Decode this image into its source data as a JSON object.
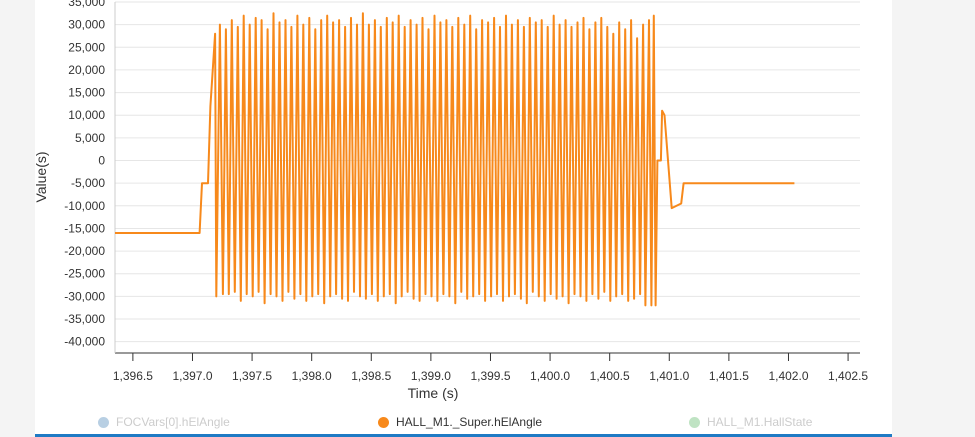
{
  "chart_data": {
    "type": "line",
    "xlabel": "Time (s)",
    "ylabel": "Value(s)",
    "xlim": [
      1396.35,
      1402.6
    ],
    "ylim": [
      -42500,
      35000
    ],
    "x_ticks": [
      "1,396.5",
      "1,397.0",
      "1,397.5",
      "1,398.0",
      "1,398.5",
      "1,399.0",
      "1,399.5",
      "1,400.0",
      "1,400.5",
      "1,401.0",
      "1,401.5",
      "1,402.0",
      "1,402.5"
    ],
    "x_tick_values": [
      1396.5,
      1397.0,
      1397.5,
      1398.0,
      1398.5,
      1399.0,
      1399.5,
      1400.0,
      1400.5,
      1401.0,
      1401.5,
      1402.0,
      1402.5
    ],
    "y_ticks": [
      "35,000",
      "30,000",
      "25,000",
      "20,000",
      "15,000",
      "10,000",
      "5,000",
      "0",
      "-5,000",
      "-10,000",
      "-15,000",
      "-20,000",
      "-25,000",
      "-30,000",
      "-35,000",
      "-40,000"
    ],
    "y_tick_values": [
      35000,
      30000,
      25000,
      20000,
      15000,
      10000,
      5000,
      0,
      -5000,
      -10000,
      -15000,
      -20000,
      -25000,
      -30000,
      -35000,
      -40000
    ],
    "grid": true,
    "legend_placement": "bottom",
    "series": [
      {
        "name": "FOCVars[0].hElAngle",
        "color": "#b8cfe3",
        "visible": false,
        "points": []
      },
      {
        "name": "HALL_M1._Super.hElAngle",
        "color": "#f7891b",
        "visible": true,
        "points": [
          [
            1396.35,
            -16000
          ],
          [
            1397.06,
            -16000
          ],
          [
            1397.08,
            -5000
          ],
          [
            1397.13,
            -5000
          ],
          [
            1397.15,
            12000
          ],
          [
            1397.19,
            28000
          ],
          [
            1397.2,
            -30000
          ],
          [
            1397.23,
            30000
          ],
          [
            1397.255,
            -29500
          ],
          [
            1397.28,
            29000
          ],
          [
            1397.305,
            -29500
          ],
          [
            1397.33,
            31000
          ],
          [
            1397.355,
            -29000
          ],
          [
            1397.38,
            29500
          ],
          [
            1397.405,
            -31000
          ],
          [
            1397.43,
            32000
          ],
          [
            1397.455,
            -29500
          ],
          [
            1397.48,
            30000
          ],
          [
            1397.505,
            -30000
          ],
          [
            1397.53,
            31500
          ],
          [
            1397.555,
            -29000
          ],
          [
            1397.58,
            31000
          ],
          [
            1397.605,
            -31500
          ],
          [
            1397.63,
            29000
          ],
          [
            1397.655,
            -29500
          ],
          [
            1397.68,
            32500
          ],
          [
            1397.705,
            -30000
          ],
          [
            1397.73,
            30500
          ],
          [
            1397.755,
            -31000
          ],
          [
            1397.78,
            31000
          ],
          [
            1397.805,
            -29000
          ],
          [
            1397.83,
            29500
          ],
          [
            1397.855,
            -30500
          ],
          [
            1397.88,
            32000
          ],
          [
            1397.905,
            -29500
          ],
          [
            1397.93,
            30000
          ],
          [
            1397.955,
            -31000
          ],
          [
            1397.98,
            31500
          ],
          [
            1398.005,
            -30000
          ],
          [
            1398.03,
            29000
          ],
          [
            1398.055,
            -29500
          ],
          [
            1398.08,
            31000
          ],
          [
            1398.105,
            -31500
          ],
          [
            1398.13,
            32000
          ],
          [
            1398.155,
            -30000
          ],
          [
            1398.18,
            30500
          ],
          [
            1398.205,
            -29500
          ],
          [
            1398.23,
            31000
          ],
          [
            1398.255,
            -30500
          ],
          [
            1398.28,
            29500
          ],
          [
            1398.305,
            -31000
          ],
          [
            1398.33,
            31500
          ],
          [
            1398.355,
            -29000
          ],
          [
            1398.38,
            30000
          ],
          [
            1398.405,
            -30000
          ],
          [
            1398.43,
            32500
          ],
          [
            1398.455,
            -30500
          ],
          [
            1398.48,
            30000
          ],
          [
            1398.505,
            -29500
          ],
          [
            1398.53,
            31000
          ],
          [
            1398.555,
            -31000
          ],
          [
            1398.58,
            29500
          ],
          [
            1398.605,
            -30000
          ],
          [
            1398.63,
            31500
          ],
          [
            1398.655,
            -29500
          ],
          [
            1398.68,
            30500
          ],
          [
            1398.705,
            -31500
          ],
          [
            1398.73,
            32000
          ],
          [
            1398.755,
            -30000
          ],
          [
            1398.78,
            29500
          ],
          [
            1398.805,
            -29000
          ],
          [
            1398.83,
            31000
          ],
          [
            1398.855,
            -30500
          ],
          [
            1398.88,
            30000
          ],
          [
            1398.905,
            -31000
          ],
          [
            1398.93,
            31500
          ],
          [
            1398.955,
            -29500
          ],
          [
            1398.98,
            29000
          ],
          [
            1399.005,
            -30000
          ],
          [
            1399.03,
            32000
          ],
          [
            1399.055,
            -31000
          ],
          [
            1399.08,
            30500
          ],
          [
            1399.105,
            -29500
          ],
          [
            1399.13,
            31000
          ],
          [
            1399.155,
            -30000
          ],
          [
            1399.18,
            29500
          ],
          [
            1399.205,
            -31500
          ],
          [
            1399.23,
            31500
          ],
          [
            1399.255,
            -29000
          ],
          [
            1399.28,
            30000
          ],
          [
            1399.305,
            -30500
          ],
          [
            1399.33,
            32000
          ],
          [
            1399.355,
            -30000
          ],
          [
            1399.38,
            29000
          ],
          [
            1399.405,
            -29500
          ],
          [
            1399.43,
            31000
          ],
          [
            1399.455,
            -31000
          ],
          [
            1399.48,
            30500
          ],
          [
            1399.505,
            -30000
          ],
          [
            1399.53,
            31500
          ],
          [
            1399.555,
            -29500
          ],
          [
            1399.58,
            29500
          ],
          [
            1399.605,
            -31000
          ],
          [
            1399.63,
            32000
          ],
          [
            1399.655,
            -30000
          ],
          [
            1399.68,
            30000
          ],
          [
            1399.705,
            -29500
          ],
          [
            1399.73,
            31000
          ],
          [
            1399.755,
            -30500
          ],
          [
            1399.78,
            29500
          ],
          [
            1399.805,
            -31500
          ],
          [
            1399.83,
            31500
          ],
          [
            1399.855,
            -29000
          ],
          [
            1399.88,
            30500
          ],
          [
            1399.905,
            -30000
          ],
          [
            1399.93,
            31000
          ],
          [
            1399.955,
            -31000
          ],
          [
            1399.98,
            29500
          ],
          [
            1400.005,
            -29500
          ],
          [
            1400.03,
            32000
          ],
          [
            1400.055,
            -30500
          ],
          [
            1400.08,
            30000
          ],
          [
            1400.105,
            -30000
          ],
          [
            1400.13,
            31000
          ],
          [
            1400.155,
            -31500
          ],
          [
            1400.18,
            29500
          ],
          [
            1400.205,
            -29500
          ],
          [
            1400.23,
            30500
          ],
          [
            1400.255,
            -30000
          ],
          [
            1400.28,
            31500
          ],
          [
            1400.305,
            -31000
          ],
          [
            1400.33,
            29000
          ],
          [
            1400.355,
            -29500
          ],
          [
            1400.38,
            30500
          ],
          [
            1400.405,
            -30500
          ],
          [
            1400.43,
            31500
          ],
          [
            1400.455,
            -29000
          ],
          [
            1400.48,
            29500
          ],
          [
            1400.505,
            -31000
          ],
          [
            1400.53,
            28000
          ],
          [
            1400.555,
            -30000
          ],
          [
            1400.58,
            30500
          ],
          [
            1400.605,
            -29500
          ],
          [
            1400.63,
            29000
          ],
          [
            1400.655,
            -31000
          ],
          [
            1400.68,
            31000
          ],
          [
            1400.705,
            -30500
          ],
          [
            1400.73,
            27000
          ],
          [
            1400.755,
            -29500
          ],
          [
            1400.78,
            30000
          ],
          [
            1400.8,
            -32000
          ],
          [
            1400.83,
            31000
          ],
          [
            1400.85,
            -32000
          ],
          [
            1400.87,
            32000
          ],
          [
            1400.885,
            -32000
          ],
          [
            1400.9,
            0
          ],
          [
            1400.93,
            0
          ],
          [
            1400.94,
            11000
          ],
          [
            1400.96,
            10000
          ],
          [
            1401.02,
            -10500
          ],
          [
            1401.1,
            -9500
          ],
          [
            1401.12,
            -5000
          ],
          [
            1402.05,
            -5000
          ]
        ]
      },
      {
        "name": "HALL_M1.HallState",
        "color": "#bfe3c3",
        "visible": false,
        "points": []
      }
    ]
  }
}
